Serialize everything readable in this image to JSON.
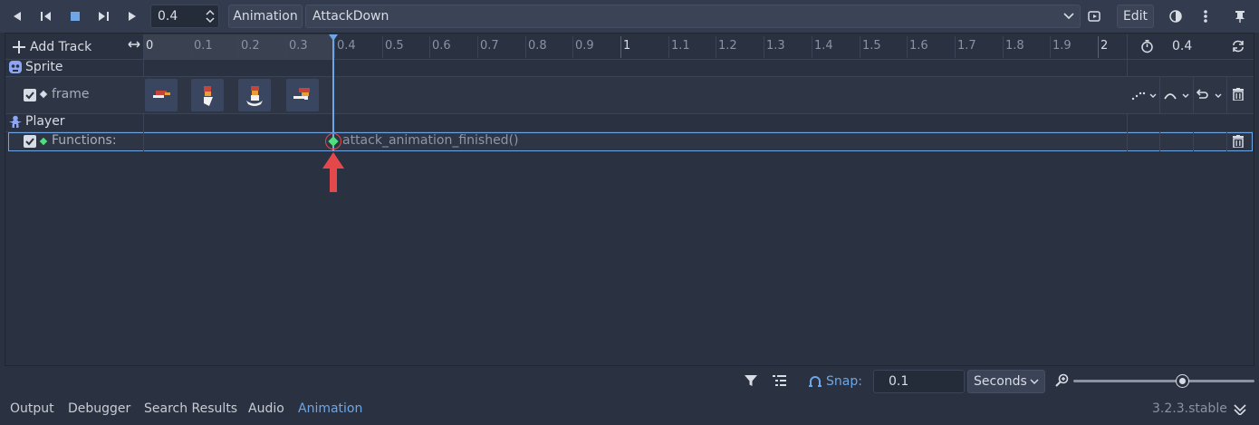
{
  "toolbar": {
    "time_value": "0.4",
    "animation_label": "Animation",
    "animation_name": "AttackDown",
    "edit_label": "Edit"
  },
  "timeline": {
    "add_track_label": "Add Track",
    "ticks": [
      "0",
      "0.1",
      "0.2",
      "0.3",
      "0.4",
      "0.5",
      "0.6",
      "0.7",
      "0.8",
      "0.9",
      "1",
      "1.1",
      "1.2",
      "1.3",
      "1.4",
      "1.5",
      "1.6",
      "1.7",
      "1.8",
      "1.9",
      "2"
    ],
    "length_value": "0.4",
    "playhead_time": 0.4
  },
  "tracks": {
    "sprite_group": "Sprite",
    "frame_track": "frame",
    "player_group": "Player",
    "functions_track": "Functions:",
    "function_key_label": "attack_animation_finished()"
  },
  "bottom": {
    "snap_label": "Snap:",
    "snap_value": "0.1",
    "snap_unit": "Seconds"
  },
  "dock_tabs": {
    "output": "Output",
    "debugger": "Debugger",
    "search_results": "Search Results",
    "audio": "Audio",
    "animation": "Animation"
  },
  "version": "3.2.3.stable",
  "colors": {
    "accent": "#6ea6e6",
    "playhead": "#6ea6e6",
    "arrow": "#e4484a",
    "key_green": "#4ee07a"
  }
}
